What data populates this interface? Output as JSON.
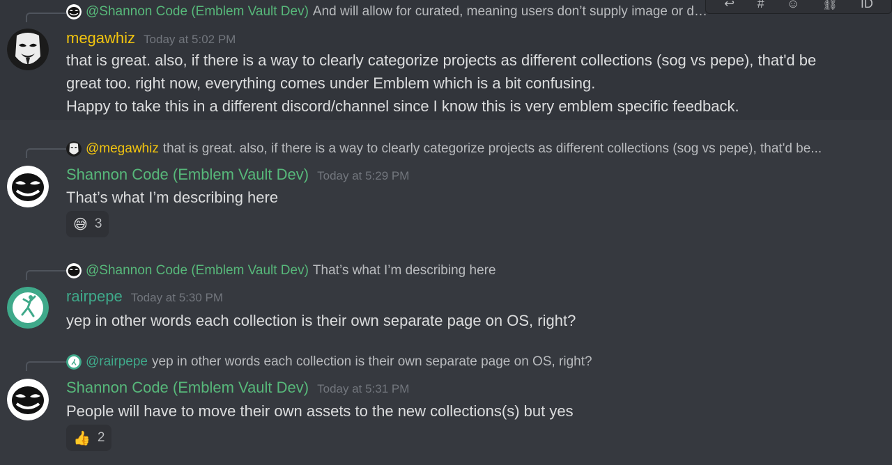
{
  "toolbar": {
    "icons": [
      "reply-icon",
      "thread-icon",
      "react-icon",
      "link-icon",
      "id-icon"
    ],
    "id_label": "ID"
  },
  "messages": [
    {
      "reply": {
        "author": "@Shannon Code (Emblem Vault Dev)",
        "text": "And will allow for curated, meaning users don’t supply image or d…"
      },
      "author": "megawhiz",
      "author_color": "#f1c40f",
      "timestamp": "Today at 5:02 PM",
      "lines": [
        "that is great. also, if there is a way to clearly categorize projects as different collections (sog vs pepe), that'd be",
        "great too. right now, everything comes under Emblem which is a bit confusing.",
        "Happy to take this in a different discord/channel since I know this is very emblem specific feedback."
      ]
    },
    {
      "reply": {
        "author": "@megawhiz",
        "text": "that is great. also, if there is a way to clearly categorize projects as different collections (sog vs pepe), that'd be..."
      },
      "author": "Shannon Code (Emblem Vault Dev)",
      "author_color": "#57b87a",
      "timestamp": "Today at 5:29 PM",
      "lines": [
        "That’s what I’m describing here"
      ],
      "reaction": {
        "emoji": "😅",
        "count": "3"
      }
    },
    {
      "reply": {
        "author": "@Shannon Code (Emblem Vault Dev)",
        "text": "That’s what I’m describing here"
      },
      "author": "rairpepe",
      "author_color": "#3fa98a",
      "timestamp": "Today at 5:30 PM",
      "lines": [
        "yep in other words each collection is their own separate page on OS, right?"
      ]
    },
    {
      "reply": {
        "author": "@rairpepe",
        "text": "yep in other words each collection is their own separate page on OS, right?"
      },
      "author": "Shannon Code (Emblem Vault Dev)",
      "author_color": "#57b87a",
      "timestamp": "Today at 5:31 PM",
      "lines": [
        "People will have to move their own assets to the new collections(s) but yes"
      ],
      "reaction": {
        "emoji": "👍",
        "count": "2"
      }
    }
  ]
}
